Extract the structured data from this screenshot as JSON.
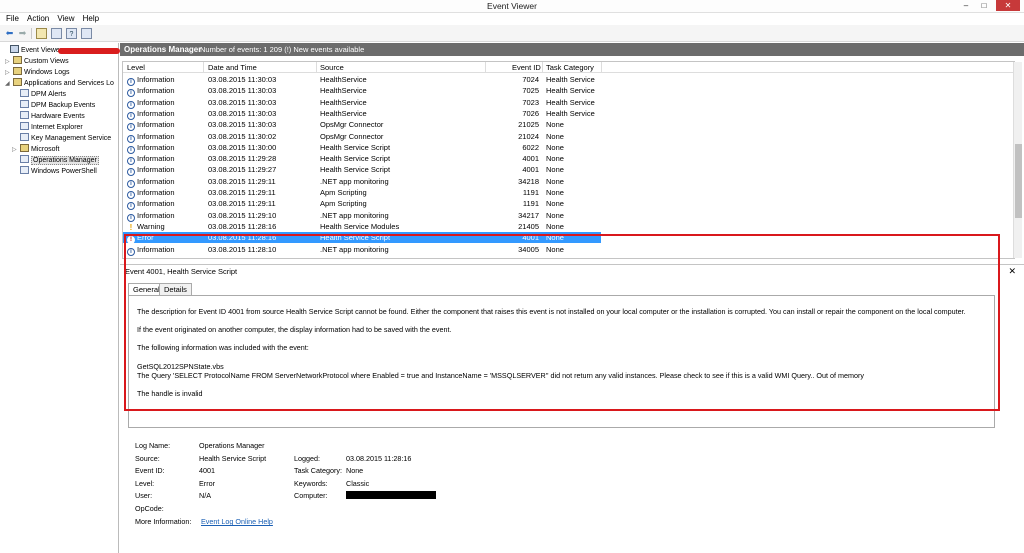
{
  "window": {
    "title": "Event Viewer",
    "minimize": "–",
    "maximize": "□",
    "close": "✕"
  },
  "menu": [
    "File",
    "Action",
    "View",
    "Help"
  ],
  "toolbar": {
    "back_icon": "⬅",
    "forward_icon": "➡",
    "help_icon": "?"
  },
  "tree": {
    "items": [
      {
        "label": "Event Viewer",
        "arrow": "",
        "indent": 0,
        "kind": "root"
      },
      {
        "label": "Custom Views",
        "arrow": "▷",
        "indent": 1,
        "kind": "folder"
      },
      {
        "label": "Windows Logs",
        "arrow": "▷",
        "indent": 1,
        "kind": "folder"
      },
      {
        "label": "Applications and Services Lo",
        "arrow": "◢",
        "indent": 1,
        "kind": "folder"
      },
      {
        "label": "DPM Alerts",
        "arrow": "",
        "indent": 2,
        "kind": "log"
      },
      {
        "label": "DPM Backup Events",
        "arrow": "",
        "indent": 2,
        "kind": "log"
      },
      {
        "label": "Hardware Events",
        "arrow": "",
        "indent": 2,
        "kind": "log"
      },
      {
        "label": "Internet Explorer",
        "arrow": "",
        "indent": 2,
        "kind": "log"
      },
      {
        "label": "Key Management Service",
        "arrow": "",
        "indent": 2,
        "kind": "log"
      },
      {
        "label": "Microsoft",
        "arrow": "▷",
        "indent": 2,
        "kind": "folder"
      },
      {
        "label": "Operations Manager",
        "arrow": "",
        "indent": 2,
        "kind": "log",
        "selected": true
      },
      {
        "label": "Windows PowerShell",
        "arrow": "",
        "indent": 2,
        "kind": "log"
      }
    ]
  },
  "pane": {
    "title": "Operations Manager",
    "count_text": "Number of events: 1 209 (!) New events available"
  },
  "grid": {
    "columns": [
      "Level",
      "Date and Time",
      "Source",
      "Event ID",
      "Task Category"
    ],
    "rows": [
      {
        "level": "Information",
        "icon": "i",
        "date": "03.08.2015 11:30:03",
        "source": "HealthService",
        "id": "7024",
        "cat": "Health Service"
      },
      {
        "level": "Information",
        "icon": "i",
        "date": "03.08.2015 11:30:03",
        "source": "HealthService",
        "id": "7025",
        "cat": "Health Service"
      },
      {
        "level": "Information",
        "icon": "i",
        "date": "03.08.2015 11:30:03",
        "source": "HealthService",
        "id": "7023",
        "cat": "Health Service"
      },
      {
        "level": "Information",
        "icon": "i",
        "date": "03.08.2015 11:30:03",
        "source": "HealthService",
        "id": "7026",
        "cat": "Health Service"
      },
      {
        "level": "Information",
        "icon": "i",
        "date": "03.08.2015 11:30:03",
        "source": "OpsMgr Connector",
        "id": "21025",
        "cat": "None"
      },
      {
        "level": "Information",
        "icon": "i",
        "date": "03.08.2015 11:30:02",
        "source": "OpsMgr Connector",
        "id": "21024",
        "cat": "None"
      },
      {
        "level": "Information",
        "icon": "i",
        "date": "03.08.2015 11:30:00",
        "source": "Health Service Script",
        "id": "6022",
        "cat": "None"
      },
      {
        "level": "Information",
        "icon": "i",
        "date": "03.08.2015 11:29:28",
        "source": "Health Service Script",
        "id": "4001",
        "cat": "None"
      },
      {
        "level": "Information",
        "icon": "i",
        "date": "03.08.2015 11:29:27",
        "source": "Health Service Script",
        "id": "4001",
        "cat": "None"
      },
      {
        "level": "Information",
        "icon": "i",
        "date": "03.08.2015 11:29:11",
        "source": ".NET app monitoring",
        "id": "34218",
        "cat": "None"
      },
      {
        "level": "Information",
        "icon": "i",
        "date": "03.08.2015 11:29:11",
        "source": "Apm Scripting",
        "id": "1191",
        "cat": "None"
      },
      {
        "level": "Information",
        "icon": "i",
        "date": "03.08.2015 11:29:11",
        "source": "Apm Scripting",
        "id": "1191",
        "cat": "None"
      },
      {
        "level": "Information",
        "icon": "i",
        "date": "03.08.2015 11:29:10",
        "source": ".NET app monitoring",
        "id": "34217",
        "cat": "None"
      },
      {
        "level": "Warning",
        "icon": "!",
        "date": "03.08.2015 11:28:16",
        "source": "Health Service Modules",
        "id": "21405",
        "cat": "None"
      },
      {
        "level": "Error",
        "icon": "!",
        "date": "03.08.2015 11:28:16",
        "source": "Health Service Script",
        "id": "4001",
        "cat": "None",
        "selected": true
      },
      {
        "level": "Information",
        "icon": "i",
        "date": "03.08.2015 11:28:10",
        "source": ".NET app monitoring",
        "id": "34005",
        "cat": "None"
      }
    ]
  },
  "detail": {
    "header": "Event 4001, Health Service Script",
    "close": "✕",
    "tabs": [
      "General",
      "Details"
    ],
    "description": [
      "The description for Event ID 4001 from source Health Service Script cannot be found. Either the component that raises this event is not installed on your local computer or the installation is corrupted. You can install or repair the component on the local computer.",
      "If the event originated on another computer, the display information had to be saved with the event.",
      "The following information was included with the event:",
      "GetSQL2012SPNState.vbs",
      "The Query 'SELECT ProtocolName FROM ServerNetworkProtocol where Enabled = true and InstanceName = 'MSSQLSERVER'' did not return any valid instances.  Please check to see if this is a valid WMI Query.. Out of memory",
      "The handle is invalid"
    ],
    "props": {
      "log_name_label": "Log Name:",
      "log_name": "Operations Manager",
      "source_label": "Source:",
      "source": "Health Service Script",
      "logged_label": "Logged:",
      "logged": "03.08.2015 11:28:16",
      "event_id_label": "Event ID:",
      "event_id": "4001",
      "task_label": "Task Category:",
      "task": "None",
      "level_label": "Level:",
      "level": "Error",
      "keywords_label": "Keywords:",
      "keywords": "Classic",
      "user_label": "User:",
      "user": "N/A",
      "computer_label": "Computer:",
      "opcode_label": "OpCode:",
      "more_label": "More Information:",
      "more_link": "Event Log Online Help"
    }
  }
}
